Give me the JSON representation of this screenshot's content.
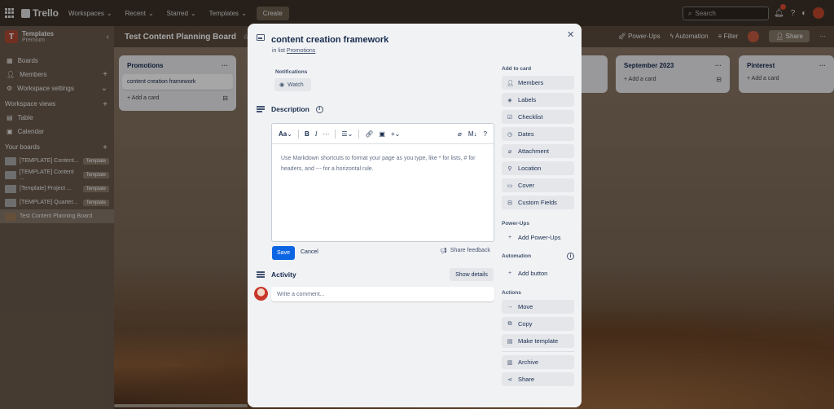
{
  "topbar": {
    "logo": "Trello",
    "nav": [
      "Workspaces",
      "Recent",
      "Starred",
      "Templates"
    ],
    "create": "Create",
    "search_placeholder": "Search"
  },
  "sidebar": {
    "workspace_initial": "T",
    "workspace_name": "Templates",
    "workspace_plan": "Premium",
    "items": [
      {
        "label": "Boards",
        "icon": "board-icon"
      },
      {
        "label": "Members",
        "icon": "members-icon"
      },
      {
        "label": "Workspace settings",
        "icon": "gear-icon"
      }
    ],
    "views_title": "Workspace views",
    "views": [
      {
        "label": "Table",
        "icon": "table-icon"
      },
      {
        "label": "Calendar",
        "icon": "calendar-icon"
      }
    ],
    "boards_title": "Your boards",
    "boards": [
      {
        "label": "[TEMPLATE] Content...",
        "tag": "Template"
      },
      {
        "label": "[TEMPLATE] Content ...",
        "tag": "Template"
      },
      {
        "label": "[Template] Project ...",
        "tag": "Template"
      },
      {
        "label": "[TEMPLATE] Quarter...",
        "tag": "Template"
      },
      {
        "label": "Test Content Planning Board",
        "tag": ""
      }
    ]
  },
  "board": {
    "title": "Test Content Planning Board",
    "powerups": "Power-Ups",
    "automation": "Automation",
    "filter": "Filter",
    "share": "Share",
    "lists": [
      {
        "title": "Promotions",
        "cards": [
          "content creation framework"
        ],
        "add": "+ Add a card"
      },
      {
        "title": "September 2023",
        "cards": [],
        "add": "+ Add a card"
      },
      {
        "title": "Pinterest",
        "cards": [],
        "add": "+ Add a card"
      },
      {
        "title": "",
        "cards": [],
        "add": ""
      }
    ]
  },
  "modal": {
    "title": "content creation framework",
    "in_list_prefix": "in list",
    "list_name": "Promotions",
    "notifications_label": "Notifications",
    "watch": "Watch",
    "description_label": "Description",
    "toolbar": {
      "text_style": "Aa",
      "bold": "B",
      "italic": "I",
      "more": "···",
      "markdown": "M↓",
      "help": "?"
    },
    "editor_placeholder": "Use Markdown shortcuts to format your page as you type, like * for lists, # for headers, and --- for a horizontal rule.",
    "save": "Save",
    "cancel": "Cancel",
    "share_feedback": "Share feedback",
    "activity_label": "Activity",
    "show_details": "Show details",
    "comment_placeholder": "Write a comment...",
    "add_to_card_label": "Add to card",
    "add_to_card": [
      {
        "label": "Members",
        "icon": "person-icon"
      },
      {
        "label": "Labels",
        "icon": "tag-icon"
      },
      {
        "label": "Checklist",
        "icon": "checklist-icon"
      },
      {
        "label": "Dates",
        "icon": "clock-icon"
      },
      {
        "label": "Attachment",
        "icon": "paperclip-icon"
      },
      {
        "label": "Location",
        "icon": "pin-icon"
      },
      {
        "label": "Cover",
        "icon": "cover-icon"
      },
      {
        "label": "Custom Fields",
        "icon": "fields-icon"
      }
    ],
    "powerups_label": "Power-Ups",
    "add_powerups": "Add Power-Ups",
    "automation_label": "Automation",
    "add_button": "Add button",
    "actions_label": "Actions",
    "actions": [
      {
        "label": "Move",
        "icon": "arrow-right-icon"
      },
      {
        "label": "Copy",
        "icon": "copy-icon"
      },
      {
        "label": "Make template",
        "icon": "template-icon"
      },
      {
        "label": "Archive",
        "icon": "archive-icon"
      },
      {
        "label": "Share",
        "icon": "share-icon"
      }
    ]
  }
}
